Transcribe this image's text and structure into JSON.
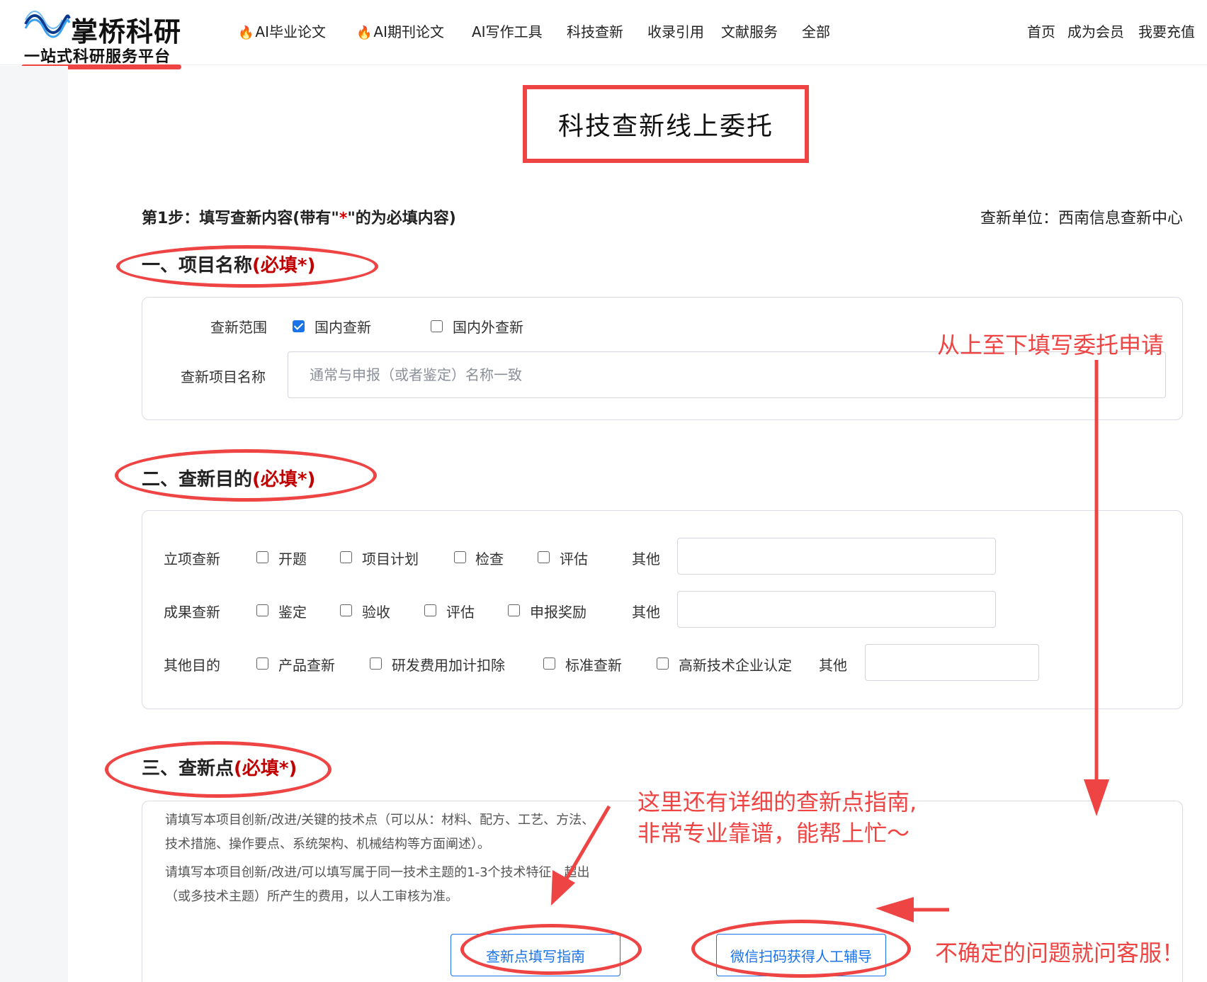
{
  "brand": {
    "title": "掌桥科研",
    "subtitle": "一站式科研服务平台",
    "colors": {
      "wave_dark": "#0b3a8c",
      "wave_light": "#3aa0f0",
      "accent": "#ef4444",
      "primary": "#1a73e8"
    }
  },
  "nav": {
    "items": [
      {
        "label": "AI毕业论文",
        "icon": "fire-icon"
      },
      {
        "label": "AI期刊论文",
        "icon": "fire-icon"
      },
      {
        "label": "AI写作工具"
      },
      {
        "label": "科技查新"
      },
      {
        "label": "收录引用"
      },
      {
        "label": "文献服务"
      },
      {
        "label": "全部"
      }
    ],
    "right": [
      "首页",
      "成为会员",
      "我要充值"
    ]
  },
  "page": {
    "title": "科技查新线上委托",
    "step_prefix": "第1步：填写查新内容(带有\"",
    "step_star": "*",
    "step_suffix": "\"的为必填内容)",
    "unit": "查新单位：西南信息查新中心"
  },
  "section1": {
    "title": "一、项目名称",
    "required": "(必填*)",
    "scope_label": "查新范围",
    "scope_options": [
      {
        "label": "国内查新",
        "checked": true
      },
      {
        "label": "国内外查新",
        "checked": false
      }
    ],
    "project_name_label": "查新项目名称",
    "project_name_placeholder": "通常与申报（或者鉴定）名称一致"
  },
  "section2": {
    "title": "二、查新目的",
    "required": "(必填*)",
    "rows": [
      {
        "label": "立项查新",
        "options": [
          "开题",
          "项目计划",
          "检查",
          "评估"
        ],
        "other_label": "其他"
      },
      {
        "label": "成果查新",
        "options": [
          "鉴定",
          "验收",
          "评估",
          "申报奖励"
        ],
        "other_label": "其他"
      },
      {
        "label": "其他目的",
        "options": [
          "产品查新",
          "研发费用加计扣除",
          "标准查新",
          "高新技术企业认定"
        ],
        "other_label": "其他"
      }
    ]
  },
  "section3": {
    "title": "三、查新点",
    "required": "(必填*)",
    "hint1_line1": "请填写本项目创新/改进/关键的技术点（可以从：材料、配方、工艺、方法、",
    "hint1_line2": "技术措施、操作要点、系统架构、机械结构等方面阐述）。",
    "hint2_line1": "请填写本项目创新/改进/可以填写属于同一技术主题的1-3个技术特征，超出",
    "hint2_line2": "（或多技术主题）所产生的费用，以人工审核为准。",
    "guide_button": "查新点填写指南",
    "wechat_button": "微信扫码获得人工辅导"
  },
  "annotations": {
    "top_down": "从上至下填写委托申请",
    "guide_line1": "这里还有详细的查新点指南,",
    "guide_line2": "非常专业靠谱，能帮上忙～",
    "service": "不确定的问题就问客服！"
  }
}
